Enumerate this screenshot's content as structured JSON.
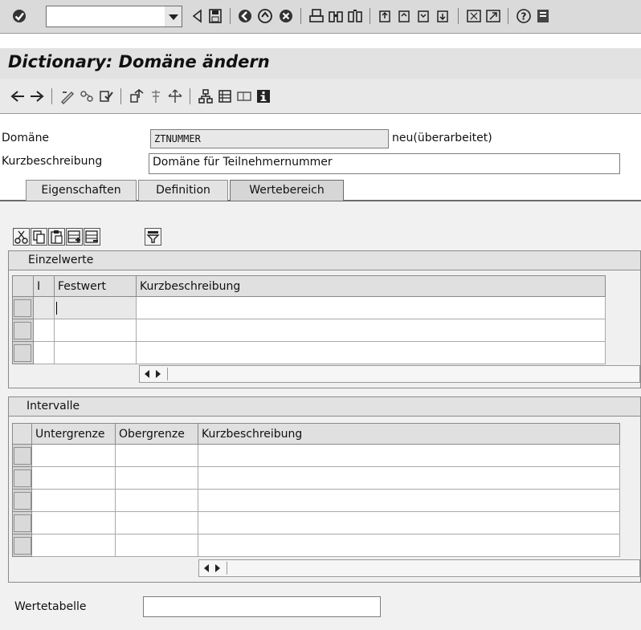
{
  "window": {
    "title": "Dictionary: Domäne ändern"
  },
  "standard_toolbar": {
    "command_field_value": "",
    "icons": [
      "enter-icon",
      "back-icon",
      "save-icon",
      "exit-icon",
      "end-icon",
      "cancel-icon",
      "print-icon",
      "find-icon",
      "find-next-icon",
      "first-page-icon",
      "previous-page-icon",
      "next-page-icon",
      "last-page-icon",
      "new-session-icon",
      "shortcut-icon",
      "help-icon",
      "layout-icon"
    ]
  },
  "application_toolbar": {
    "icons": [
      "back-arrow-icon",
      "forward-arrow-icon",
      "display-change-icon",
      "other-object-icon",
      "check-icon",
      "activate-icon",
      "where-used-icon",
      "object-list-icon",
      "hierarchy-icon",
      "navigation-icon",
      "frame-icon",
      "info-icon"
    ]
  },
  "fields": {
    "domain_label": "Domäne",
    "domain_value": "ZTNUMMER",
    "domain_status": "neu(überarbeitet)",
    "short_desc_label": "Kurzbeschreibung",
    "short_desc_value": "Domäne für Teilnehmernummer"
  },
  "tabs": [
    {
      "label": "Eigenschaften",
      "active": false
    },
    {
      "label": "Definition",
      "active": false
    },
    {
      "label": "Wertebereich",
      "active": true
    }
  ],
  "table_toolbar": {
    "icons": [
      "cut-icon",
      "copy-icon",
      "paste-icon",
      "insert-row-icon",
      "delete-row-icon",
      "filter-icon"
    ]
  },
  "single_values": {
    "caption": "Einzelwerte",
    "columns": [
      "I",
      "Festwert",
      "Kurzbeschreibung"
    ],
    "rows": [
      {
        "i": "",
        "festwert": "",
        "kurzbeschreibung": ""
      },
      {
        "i": "",
        "festwert": "",
        "kurzbeschreibung": ""
      },
      {
        "i": "",
        "festwert": "",
        "kurzbeschreibung": ""
      }
    ]
  },
  "intervals": {
    "caption": "Intervalle",
    "columns": [
      "Untergrenze",
      "Obergrenze",
      "Kurzbeschreibung"
    ],
    "rows": [
      {
        "untergrenze": "",
        "obergrenze": "",
        "kurzbeschreibung": ""
      },
      {
        "untergrenze": "",
        "obergrenze": "",
        "kurzbeschreibung": ""
      },
      {
        "untergrenze": "",
        "obergrenze": "",
        "kurzbeschreibung": ""
      },
      {
        "untergrenze": "",
        "obergrenze": "",
        "kurzbeschreibung": ""
      },
      {
        "untergrenze": "",
        "obergrenze": "",
        "kurzbeschreibung": ""
      }
    ]
  },
  "value_table": {
    "label": "Wertetabelle",
    "value": ""
  }
}
